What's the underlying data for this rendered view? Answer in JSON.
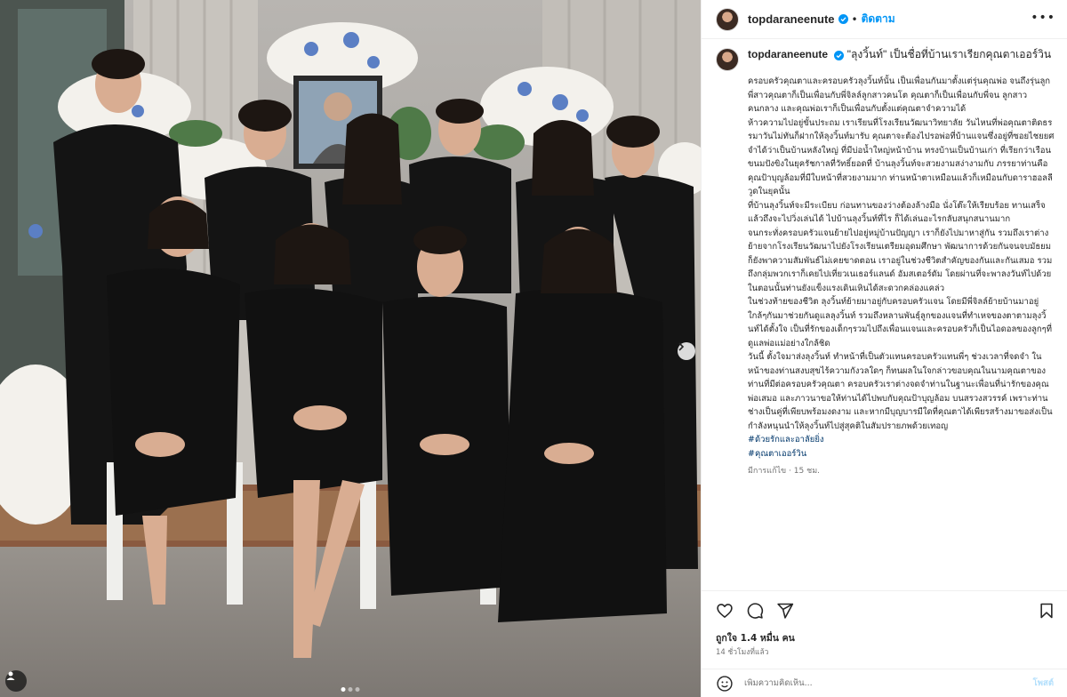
{
  "post": {
    "username": "topdaraneenute",
    "follow_label": "ติดตาม",
    "more_icon": "more-icon",
    "verified_icon": "verified-badge-icon",
    "caption_title": "\"ลุงวิ้นท์\" เป็นชื่อที่บ้านเราเรียกคุณตาเออร์วิน",
    "caption_paragraphs": [
      "ครอบครัวคุณตาและครอบครัวลุงวิ้นท์นั้น เป็นเพื่อนกันมาตั้งแต่รุ่นคุณพ่อ จนถึงรุ่นลูก พี่สาวคุณตาก็เป็นเพื่อนกับพี่จิลล์ลูกสาวคนโต คุณตาก็เป็นเพื่อนกับพี่จน ลูกสาวคนกลาง และคุณพ่อเราก็เป็นเพื่อนกับตั้งแต่คุณตาจำความได้",
      "ห้าวความไปอยู่ขั้นประถม เราเรียนที่โรงเรียนวัฒนาวิทยาลัย วันไหนที่พ่อคุณตาติดธรรมาวันไม่ทันก็ฝากให้ลุงวิ้นท์มารับ คุณตาจะต้องไปรอพ่อที่บ้านแจนซึ่งอยู่ที่ซอยไชยยศ จำได้ว่าเป็นบ้านหลังใหญ่ ที่มีบ่อน้ำใหญ่หน้าบ้าน ทรงบ้านเป็นบ้านเก่า ที่เรียกว่าเรือนขนมปังขิงในยุครัชกาลที่วัทธิ์ยอดที่ บ้านลุงวิ้นท์จะสวยงามสง่างามกับ ภรรยาท่านคือคุณป้าบุญล้อมที่มีใบหน้าที่สวยงามมาก ท่านหน้าตาเหมือนแล้วก็เหมือนกับดาราฮอลลีวูดในยุคนั้น",
      "ที่บ้านลุงวิ้นท์จะมีระเบียบ ก่อนทานของว่างต้องล้างมือ นั่งโต๊ะให้เรียบร้อย ทานเสร็จแล้วถึงจะไปวิ่งเล่นได้ ไปบ้านลุงวิ้นท์ที่ไร ก็ได้เล่นอะไรกลับสนุกสนานมาก",
      "จนกระทั่งครอบครัวแจนย้ายไปอยู่หมู่บ้านปัญญา เราก็ยังไปมาหาสู่กัน รวมถึงเราต่างย้ายจากโรงเรียนวัฒนาไปยังโรงเรียนเตรียมอุดมศึกษา พัฒนาการด้วยกันจนจบมัธยม ก็ยังพาความสัมพันธ์ไม่เคยขาดตอน เราอยู่ในช่วงชีวิตสำคัญของกันและกันเสมอ รวมถึงกลุ่มพวกเราก็เคยไปเที่ยวเนเธอร์แลนด์ อัมสเตอร์ดัม โดยผ่านที่จะพาลงวันท์ไปด้วยในตอนนั้นท่านยังแข็งแรงเดินเหินได้สะดวกคล่องแคล่ว",
      "ในช่วงท้ายของชีวิต ลุงวิ้นท์ย้ายมาอยู่กับครอบครัวแจน โดยมีพี่จิลล์ย้ายบ้านมาอยู่ใกล้ๆกันมาช่วยกันดูแลลุงวิ้นท์ รวมถึงหลานพันธุ์ลูกของแจนที่ทำเหจของตาตามลุงวิ้นท์ได้ตั้งใจ เป็นที่รักของเด็กๆรวมไปถึงเพื่อนแจนและครอบครัวก็เป็นไอดอลของลูกๆที่ดูแลพ่อแม่อย่างใกล้ชิด",
      "วันนี้ ตั้งใจมาส่งลุงวิ้นท์ ทำหน้าที่เป็นตัวแทนครอบครัวแทนพี่ๆ ช่วงเวลาที่จดจำ ในหน้าของท่านสงบสุขไร้ความกังวลใดๆ ก็ทนผลในใจกล่าวขอบคุณในนามคุณตาของท่านที่มีต่อครอบครัวคุณตา ครอบครัวเราต่างจดจำท่านในฐานะเพื่อนที่น่ารักของคุณพ่อเสมอ และภาวนาขอให้ท่านได้ไปพบกับคุณป้าบุญล้อม บนสรวงสวรรค์ เพราะท่านช่างเป็นคู่ที่เพียบพร้อมงดงาม และหากมีบุญบารมีใดที่คุณตาได้เพียรสร้างมาขอส่งเป็นกำลังหนุนนำให้ลุงวิ้นท์ไปสู่สุคติในสัมปรายภพด้วยเทอญ"
    ],
    "hashtags": [
      "#ด้วยรักและอาลัยยิ่ง",
      "#คุณตาเออร์วิน"
    ],
    "caption_time": "มีการแก้ไข · 15 ชม.",
    "likes_text": "ถูกใจ 1.4 หมื่น คน",
    "posted_ago": "14 ชั่วโมงที่แล้ว",
    "comment_placeholder": "เพิ่มความคิดเห็น...",
    "post_button": "โพสต์"
  },
  "icons": {
    "like": "heart-icon",
    "comment": "comment-icon",
    "share": "send-icon",
    "save": "bookmark-icon",
    "emoji": "emoji-icon",
    "user_tag": "user-tag-icon",
    "next": "chevron-right-icon"
  },
  "carousel": {
    "total": 3,
    "active": 0
  },
  "colors": {
    "accent": "#0095f6",
    "hashtag": "#00376b",
    "muted": "#737373",
    "border": "#efefef"
  }
}
